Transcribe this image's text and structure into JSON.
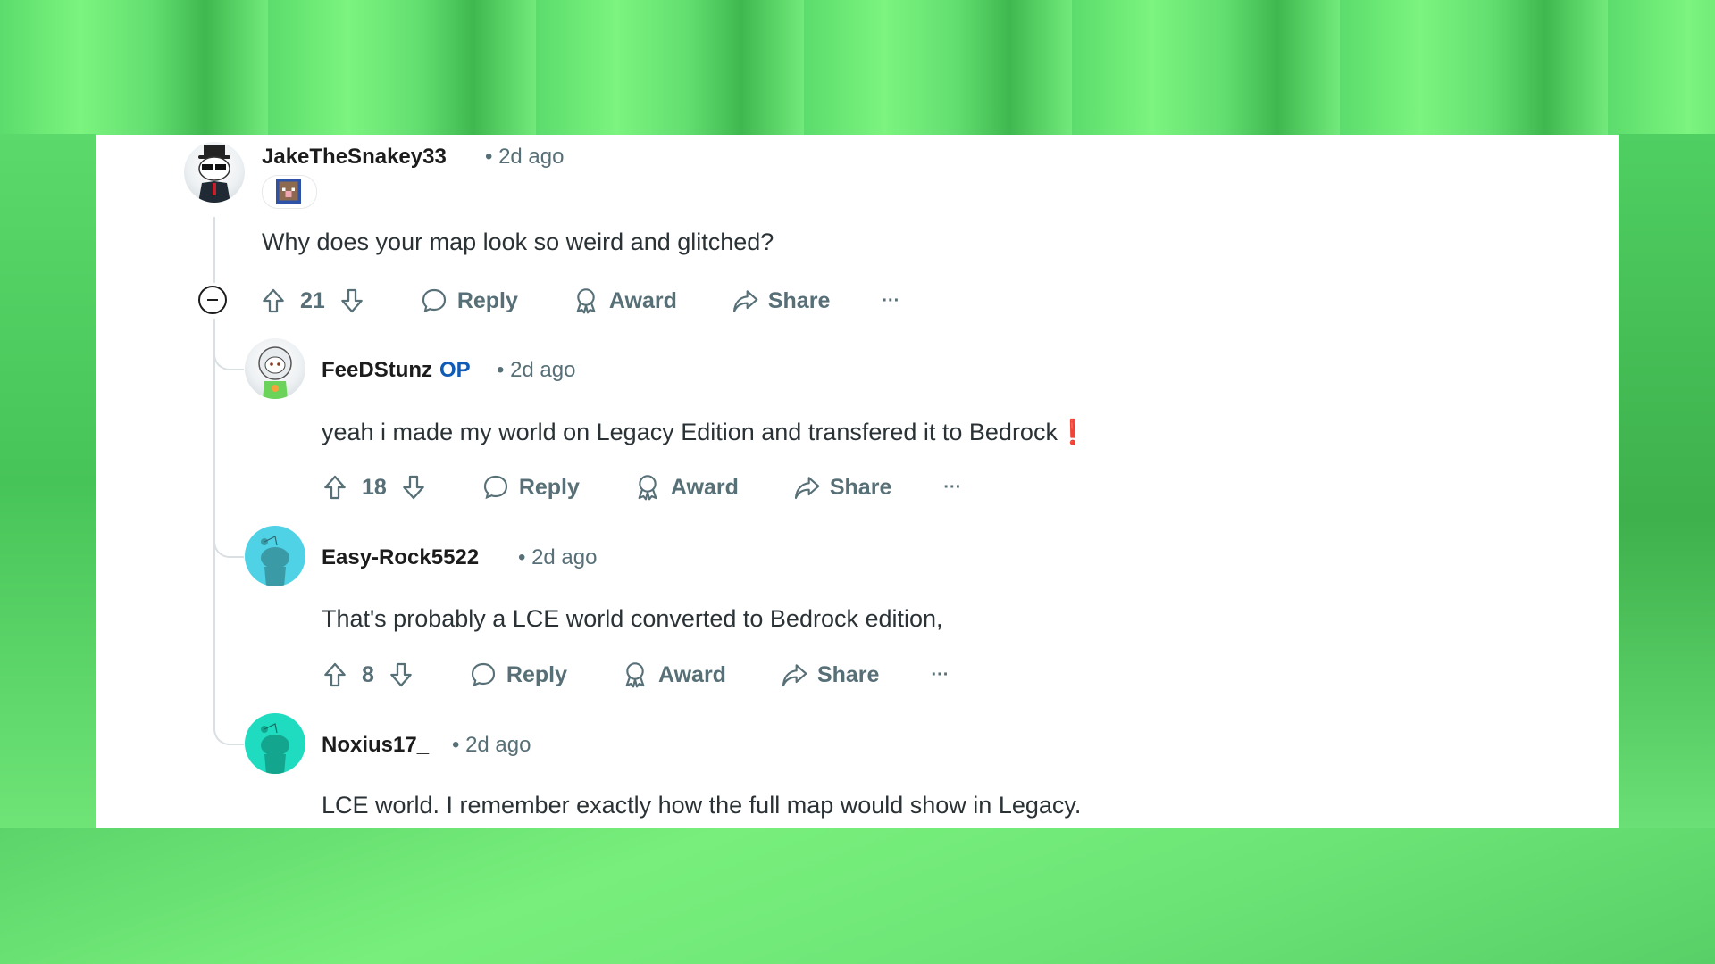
{
  "comments": [
    {
      "username": "JakeTheSnakey33",
      "op": "",
      "time": "• 2d ago",
      "body": "Why does your map look so weird and glitched?",
      "score": "21",
      "reply_label": "Reply",
      "award_label": "Award",
      "share_label": "Share",
      "more_label": "···",
      "avatar": "snoo-hat-sunglasses-avatar",
      "flair": "pixel-sheep-flair"
    },
    {
      "username": "FeeDStunz",
      "op": "OP",
      "time": "• 2d ago",
      "body": "yeah i made my world on Legacy Edition and transfered it to Bedrock",
      "emoji": "❗",
      "score": "18",
      "reply_label": "Reply",
      "award_label": "Award",
      "share_label": "Share",
      "more_label": "···",
      "avatar": "snoo-astronaut-avatar"
    },
    {
      "username": "Easy-Rock5522",
      "op": "",
      "time": "• 2d ago",
      "body": "That's probably a LCE world converted to Bedrock edition,",
      "score": "8",
      "reply_label": "Reply",
      "award_label": "Award",
      "share_label": "Share",
      "more_label": "···",
      "avatar": "default-snoo-avatar-blue"
    },
    {
      "username": "Noxius17_",
      "op": "",
      "time": "• 2d ago",
      "body": "LCE world. I remember exactly how the full map would show in Legacy.",
      "avatar": "default-snoo-avatar-teal"
    }
  ],
  "colors": {
    "background_green": "#6ee67a",
    "op_blue": "#0f5bb5",
    "meta_gray": "#576f76",
    "text_dark": "#1c1c1c",
    "exclamation_red": "#e0201a",
    "avatar_blue": "#4fd2e6",
    "avatar_teal": "#1fdcc0"
  }
}
